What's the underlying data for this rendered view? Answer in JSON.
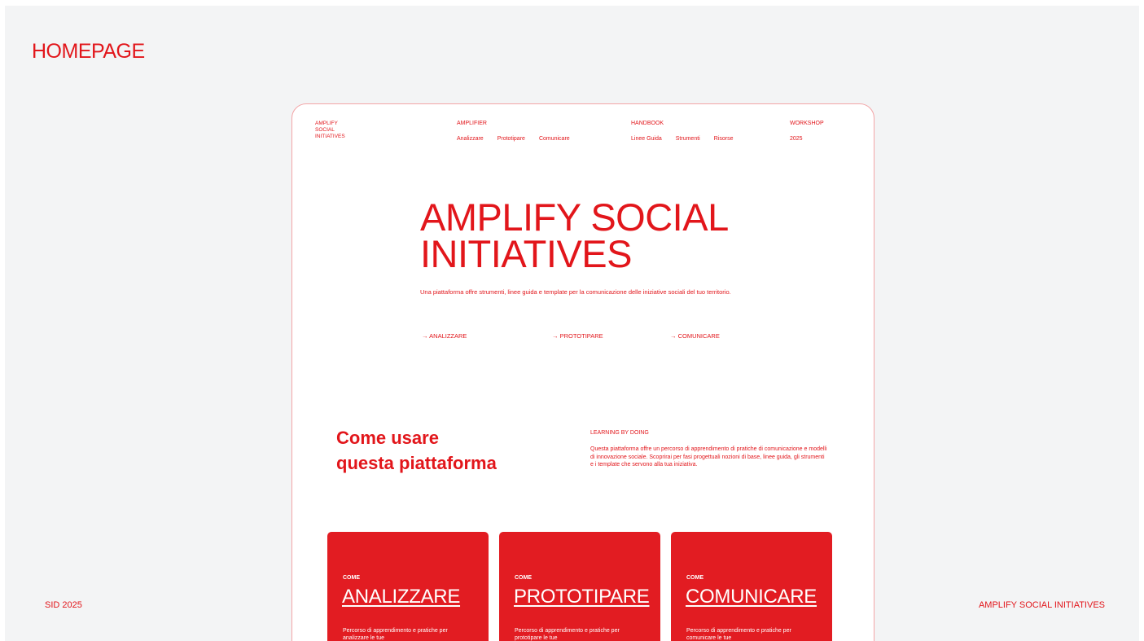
{
  "slide": {
    "title": "HOMEPAGE",
    "footer_left": "SID 2025",
    "footer_right": "AMPLIFY SOCIAL INITIATIVES"
  },
  "nav": {
    "logo": [
      "AMPLIFY",
      "SOCIAL",
      "INITIATIVES"
    ],
    "amplifier": {
      "title": "AMPLIFIER",
      "links": [
        "Analizzare",
        "Prototipare",
        "Comunicare"
      ]
    },
    "handbook": {
      "title": "HANDBOOK",
      "links": [
        "Linee Guida",
        "Strumenti",
        "Risorse"
      ]
    },
    "workshop": {
      "title": "WORKSHOP",
      "year": "2025"
    }
  },
  "hero": {
    "title_line1": "AMPLIFY SOCIAL",
    "title_line2": "INITIATIVES",
    "description": "Una piattaforma offre strumenti, linee guida e template per la comunicazione delle iniziative sociali del tuo territorio.",
    "links": [
      "→ ANALIZZARE",
      "→ PROTOTIPARE",
      "→ COMUNICARE"
    ]
  },
  "how_to": {
    "title_line1": "Come usare",
    "title_line2": "questa piattaforma",
    "label": "LEARNING BY DOING",
    "text": "Questa piattaforma offre un percorso di apprendimento di pratiche di comunicazione e modelli di innovazione sociale. Scoprirai per fasi progettuali nozioni di base, linee guida, gli strumenti e i template che servono alla tua iniziativa."
  },
  "cards": [
    {
      "pre": "COME",
      "title": "ANALIZZARE",
      "desc": "Percorso di apprendimento e pratiche per analizzare le tue"
    },
    {
      "pre": "COME",
      "title": "PROTOTIPARE",
      "desc": "Percorso di apprendimento e pratiche per prototipare le tue"
    },
    {
      "pre": "COME",
      "title": "COMUNICARE",
      "desc": "Percorso di apprendimento e pratiche per comunicare le tue"
    }
  ],
  "colors": {
    "accent": "#e2161b",
    "background": "#f3f4f5",
    "card": "#e21c22",
    "frame": "#f3a5a7"
  }
}
